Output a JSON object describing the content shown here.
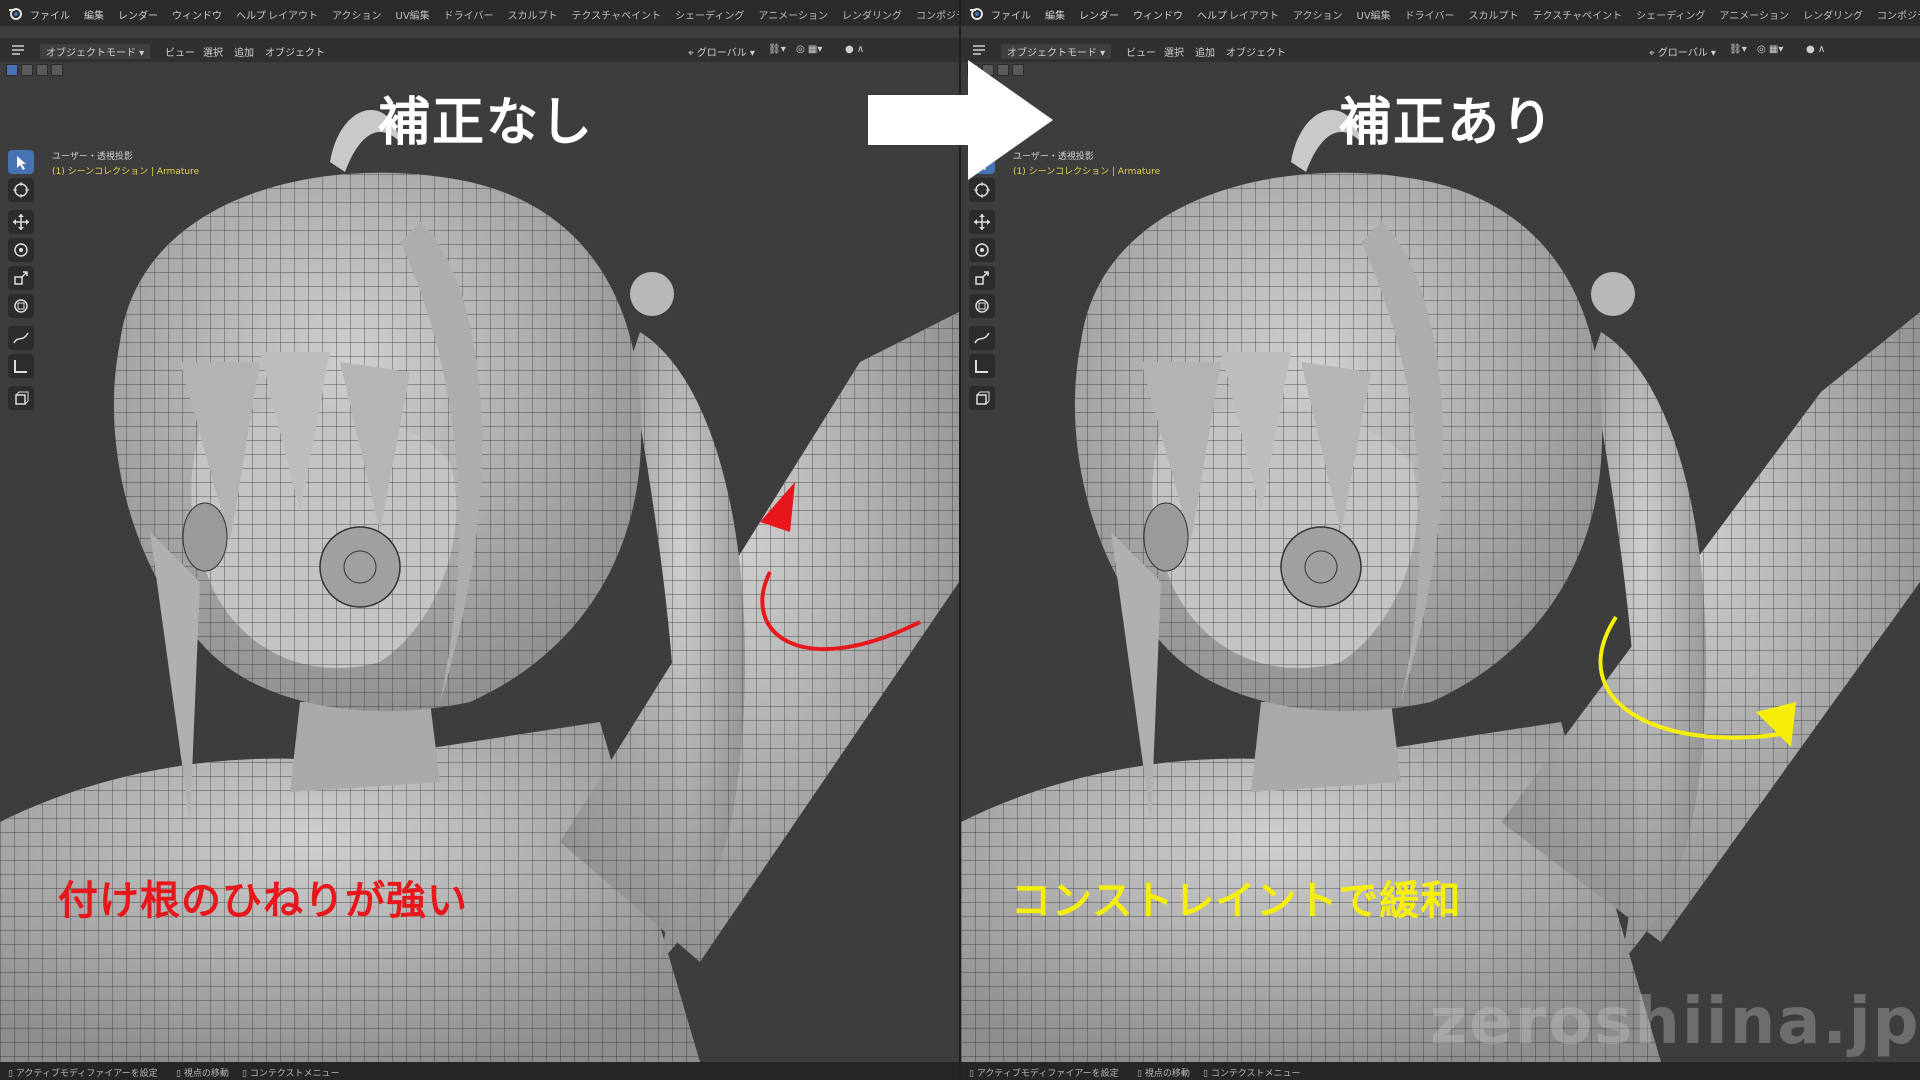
{
  "menubar": {
    "menus": [
      "ファイル",
      "編集",
      "レンダー",
      "ウィンドウ",
      "ヘルプ"
    ],
    "spaces": [
      "レイアウト",
      "アクション",
      "UV編集",
      "ドライバー",
      "スカルプト",
      "テクスチャペイント",
      "シェーディング",
      "アニメーション",
      "レンダリング",
      "コンポジティング"
    ]
  },
  "toolbar": {
    "mode": "オブジェクトモード",
    "view": "ビュー",
    "select": "選択",
    "add": "追加",
    "object": "オブジェクト",
    "transform": "グローバル"
  },
  "viewport": {
    "perspective": "ユーザー・透視投影",
    "collection": "(1) シーンコレクション | Armature"
  },
  "panels": {
    "left": {
      "title": "補正なし",
      "caption": "付け根のひねりが強い",
      "caption_color": "#e8171b",
      "arrow_color": "#e8171b"
    },
    "right": {
      "title": "補正あり",
      "caption": "コンストレイントで緩和",
      "caption_color": "#f5ee0b",
      "arrow_color": "#f5ee0b"
    }
  },
  "statusbar": {
    "item1": "アクティブモディファイアーを設定",
    "item2": "視点の移動",
    "item3": "コンテクストメニュー"
  },
  "watermark": "zeroshiina.jp"
}
